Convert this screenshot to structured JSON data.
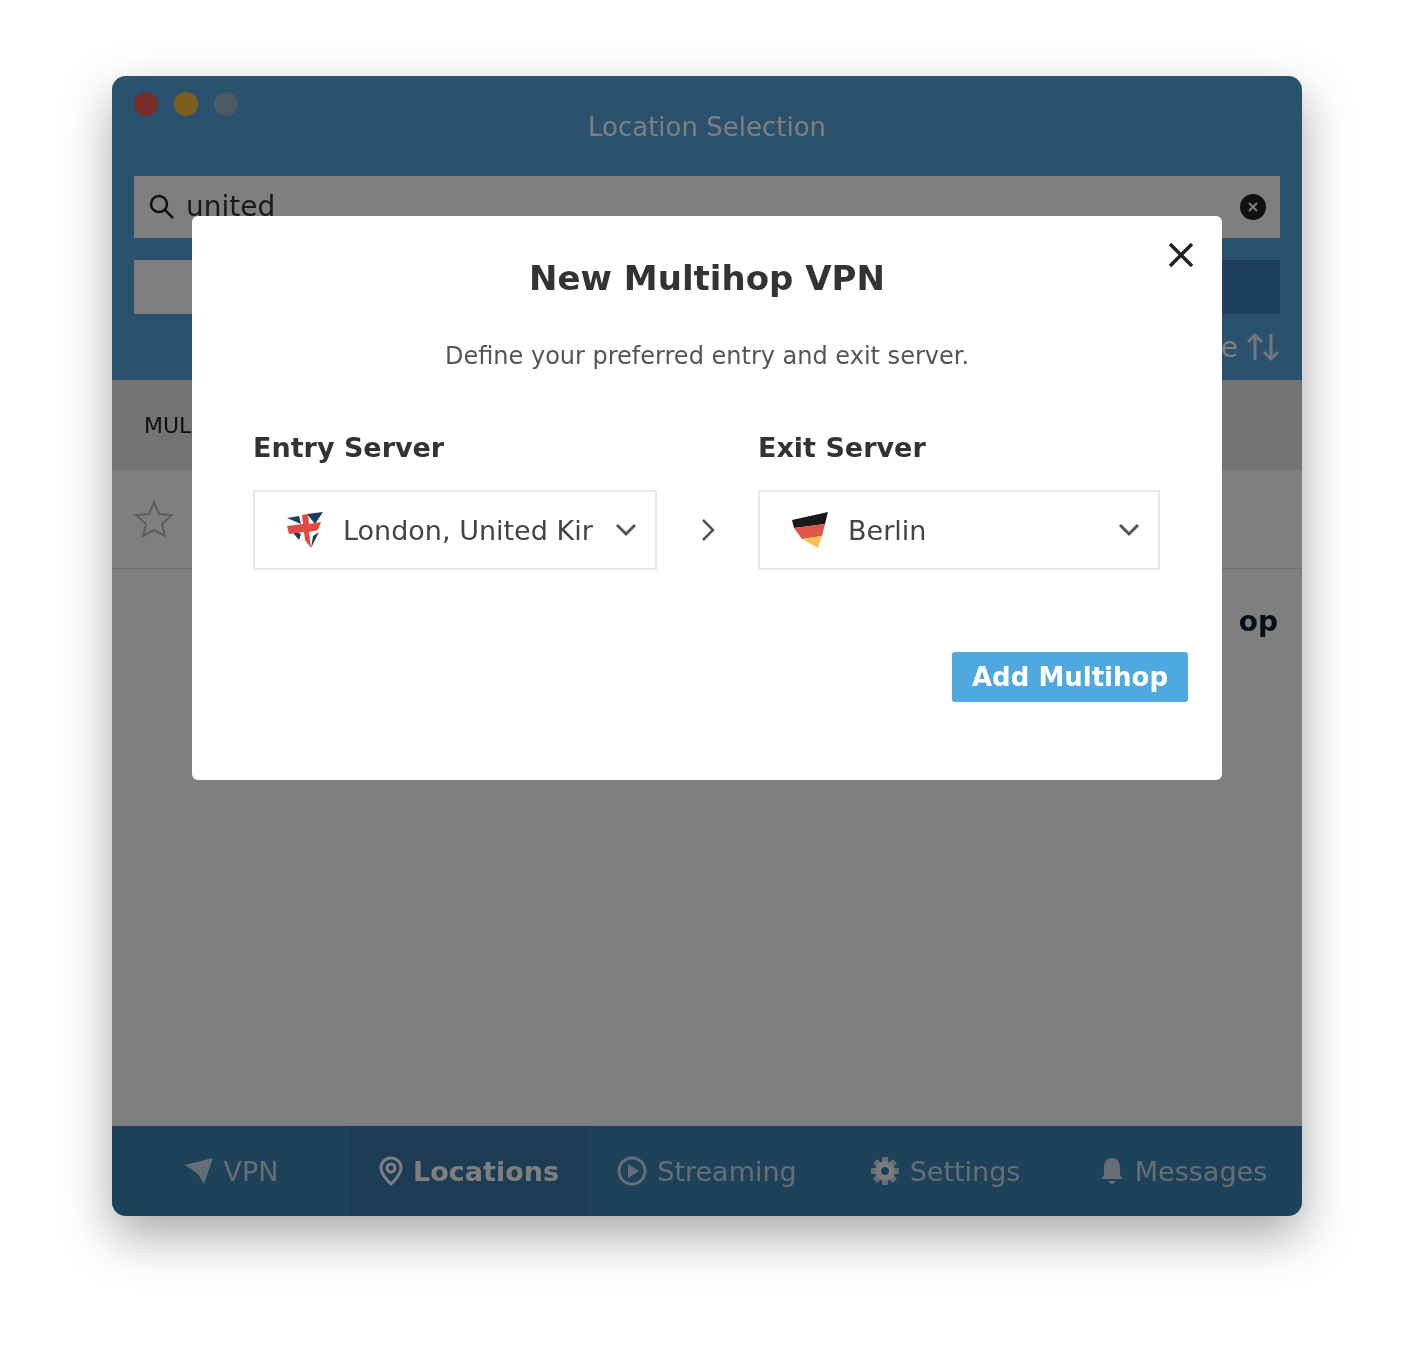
{
  "window": {
    "title": "Location Selection"
  },
  "search": {
    "value": "united"
  },
  "sort": {
    "label": "e"
  },
  "list_header": {
    "label": "MUL"
  },
  "list_row": {
    "favorite": false
  },
  "side_text": "op",
  "nav": [
    {
      "label": "VPN",
      "selected": false
    },
    {
      "label": "Locations",
      "selected": true
    },
    {
      "label": "Streaming",
      "selected": false
    },
    {
      "label": "Settings",
      "selected": false
    },
    {
      "label": "Messages",
      "selected": false
    }
  ],
  "modal": {
    "title": "New Multihop VPN",
    "subtitle": "Define your preferred entry and exit server.",
    "entry": {
      "label": "Entry Server",
      "value": "London, United Kir"
    },
    "exit": {
      "label": "Exit Server",
      "value": "Berlin"
    },
    "button": "Add Multihop"
  }
}
